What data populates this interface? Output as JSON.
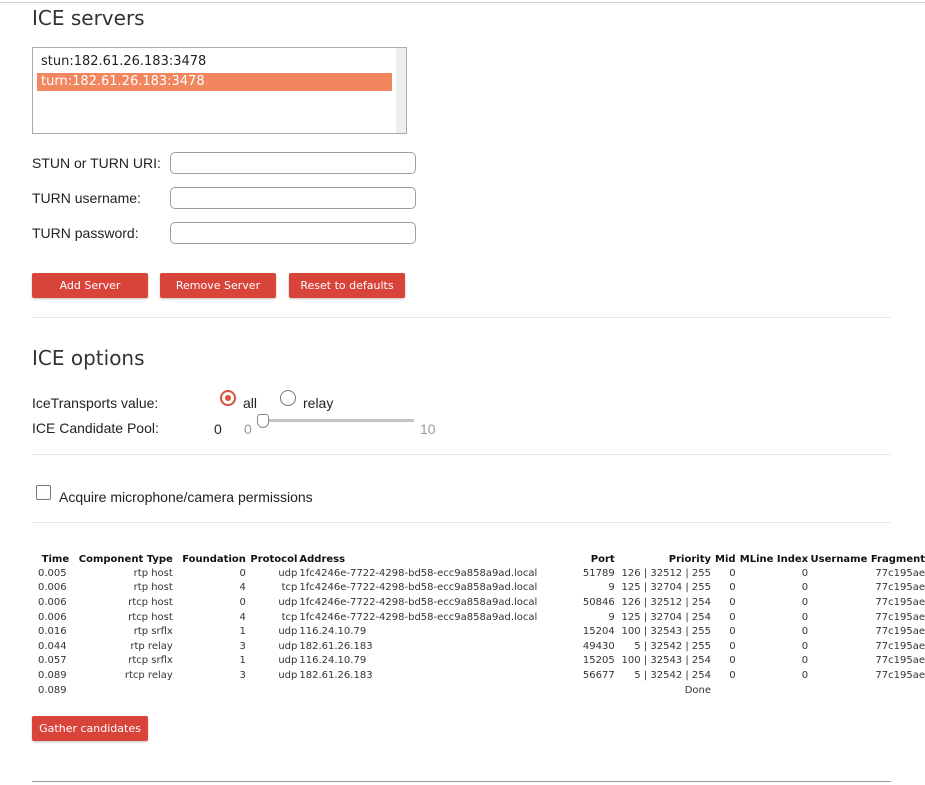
{
  "ice_servers": {
    "heading": "ICE servers",
    "servers": [
      "stun:182.61.26.183:3478",
      "turn:182.61.26.183:3478"
    ],
    "selected_index": 1,
    "uri_label": "STUN or TURN URI:",
    "uri_value": "",
    "username_label": "TURN username:",
    "username_value": "",
    "password_label": "TURN password:",
    "password_value": "",
    "add_label": "Add Server",
    "remove_label": "Remove Server",
    "reset_label": "Reset to defaults"
  },
  "ice_options": {
    "heading": "ICE options",
    "transports_label": "IceTransports value:",
    "transport_options": [
      "all",
      "relay"
    ],
    "transport_selected": "all",
    "pool_label": "ICE Candidate Pool:",
    "pool_value": "0",
    "pool_min": "0",
    "pool_max": "10"
  },
  "permissions": {
    "label": "Acquire microphone/camera permissions",
    "checked": false
  },
  "candidates": {
    "headers": [
      "Time",
      "Component Type",
      "Foundation",
      "Protocol",
      "Address",
      "Port",
      "Priority",
      "Mid",
      "MLine Index",
      "Username Fragment"
    ],
    "rows": [
      [
        "0.005",
        "rtp host",
        "0",
        "udp",
        "1fc4246e-7722-4298-bd58-ecc9a858a9ad.local",
        "51789",
        "126 | 32512 | 255",
        "0",
        "0",
        "77c195ae"
      ],
      [
        "0.006",
        "rtp host",
        "4",
        "tcp",
        "1fc4246e-7722-4298-bd58-ecc9a858a9ad.local",
        "9",
        "125 | 32704 | 255",
        "0",
        "0",
        "77c195ae"
      ],
      [
        "0.006",
        "rtcp host",
        "0",
        "udp",
        "1fc4246e-7722-4298-bd58-ecc9a858a9ad.local",
        "50846",
        "126 | 32512 | 254",
        "0",
        "0",
        "77c195ae"
      ],
      [
        "0.006",
        "rtcp host",
        "4",
        "tcp",
        "1fc4246e-7722-4298-bd58-ecc9a858a9ad.local",
        "9",
        "125 | 32704 | 254",
        "0",
        "0",
        "77c195ae"
      ],
      [
        "0.016",
        "rtp srflx",
        "1",
        "udp",
        "116.24.10.79",
        "15204",
        "100 | 32543 | 255",
        "0",
        "0",
        "77c195ae"
      ],
      [
        "0.044",
        "rtp relay",
        "3",
        "udp",
        "182.61.26.183",
        "49430",
        "5 | 32542 | 255",
        "0",
        "0",
        "77c195ae"
      ],
      [
        "0.057",
        "rtcp srflx",
        "1",
        "udp",
        "116.24.10.79",
        "15205",
        "100 | 32543 | 254",
        "0",
        "0",
        "77c195ae"
      ],
      [
        "0.089",
        "rtcp relay",
        "3",
        "udp",
        "182.61.26.183",
        "56677",
        "5 | 32542 | 254",
        "0",
        "0",
        "77c195ae"
      ]
    ],
    "final_time": "0.089",
    "done_label": "Done",
    "gather_label": "Gather candidates"
  }
}
